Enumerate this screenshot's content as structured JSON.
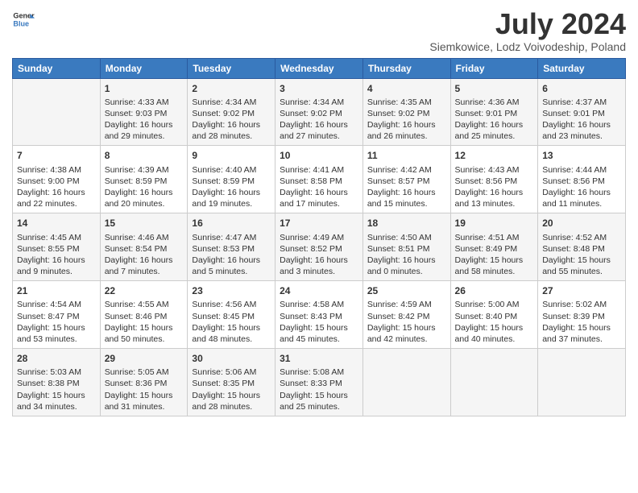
{
  "header": {
    "logo_general": "General",
    "logo_blue": "Blue",
    "month_year": "July 2024",
    "location": "Siemkowice, Lodz Voivodeship, Poland"
  },
  "days_of_week": [
    "Sunday",
    "Monday",
    "Tuesday",
    "Wednesday",
    "Thursday",
    "Friday",
    "Saturday"
  ],
  "weeks": [
    [
      {
        "day": "",
        "content": ""
      },
      {
        "day": "1",
        "content": "Sunrise: 4:33 AM\nSunset: 9:03 PM\nDaylight: 16 hours\nand 29 minutes."
      },
      {
        "day": "2",
        "content": "Sunrise: 4:34 AM\nSunset: 9:02 PM\nDaylight: 16 hours\nand 28 minutes."
      },
      {
        "day": "3",
        "content": "Sunrise: 4:34 AM\nSunset: 9:02 PM\nDaylight: 16 hours\nand 27 minutes."
      },
      {
        "day": "4",
        "content": "Sunrise: 4:35 AM\nSunset: 9:02 PM\nDaylight: 16 hours\nand 26 minutes."
      },
      {
        "day": "5",
        "content": "Sunrise: 4:36 AM\nSunset: 9:01 PM\nDaylight: 16 hours\nand 25 minutes."
      },
      {
        "day": "6",
        "content": "Sunrise: 4:37 AM\nSunset: 9:01 PM\nDaylight: 16 hours\nand 23 minutes."
      }
    ],
    [
      {
        "day": "7",
        "content": "Sunrise: 4:38 AM\nSunset: 9:00 PM\nDaylight: 16 hours\nand 22 minutes."
      },
      {
        "day": "8",
        "content": "Sunrise: 4:39 AM\nSunset: 8:59 PM\nDaylight: 16 hours\nand 20 minutes."
      },
      {
        "day": "9",
        "content": "Sunrise: 4:40 AM\nSunset: 8:59 PM\nDaylight: 16 hours\nand 19 minutes."
      },
      {
        "day": "10",
        "content": "Sunrise: 4:41 AM\nSunset: 8:58 PM\nDaylight: 16 hours\nand 17 minutes."
      },
      {
        "day": "11",
        "content": "Sunrise: 4:42 AM\nSunset: 8:57 PM\nDaylight: 16 hours\nand 15 minutes."
      },
      {
        "day": "12",
        "content": "Sunrise: 4:43 AM\nSunset: 8:56 PM\nDaylight: 16 hours\nand 13 minutes."
      },
      {
        "day": "13",
        "content": "Sunrise: 4:44 AM\nSunset: 8:56 PM\nDaylight: 16 hours\nand 11 minutes."
      }
    ],
    [
      {
        "day": "14",
        "content": "Sunrise: 4:45 AM\nSunset: 8:55 PM\nDaylight: 16 hours\nand 9 minutes."
      },
      {
        "day": "15",
        "content": "Sunrise: 4:46 AM\nSunset: 8:54 PM\nDaylight: 16 hours\nand 7 minutes."
      },
      {
        "day": "16",
        "content": "Sunrise: 4:47 AM\nSunset: 8:53 PM\nDaylight: 16 hours\nand 5 minutes."
      },
      {
        "day": "17",
        "content": "Sunrise: 4:49 AM\nSunset: 8:52 PM\nDaylight: 16 hours\nand 3 minutes."
      },
      {
        "day": "18",
        "content": "Sunrise: 4:50 AM\nSunset: 8:51 PM\nDaylight: 16 hours\nand 0 minutes."
      },
      {
        "day": "19",
        "content": "Sunrise: 4:51 AM\nSunset: 8:49 PM\nDaylight: 15 hours\nand 58 minutes."
      },
      {
        "day": "20",
        "content": "Sunrise: 4:52 AM\nSunset: 8:48 PM\nDaylight: 15 hours\nand 55 minutes."
      }
    ],
    [
      {
        "day": "21",
        "content": "Sunrise: 4:54 AM\nSunset: 8:47 PM\nDaylight: 15 hours\nand 53 minutes."
      },
      {
        "day": "22",
        "content": "Sunrise: 4:55 AM\nSunset: 8:46 PM\nDaylight: 15 hours\nand 50 minutes."
      },
      {
        "day": "23",
        "content": "Sunrise: 4:56 AM\nSunset: 8:45 PM\nDaylight: 15 hours\nand 48 minutes."
      },
      {
        "day": "24",
        "content": "Sunrise: 4:58 AM\nSunset: 8:43 PM\nDaylight: 15 hours\nand 45 minutes."
      },
      {
        "day": "25",
        "content": "Sunrise: 4:59 AM\nSunset: 8:42 PM\nDaylight: 15 hours\nand 42 minutes."
      },
      {
        "day": "26",
        "content": "Sunrise: 5:00 AM\nSunset: 8:40 PM\nDaylight: 15 hours\nand 40 minutes."
      },
      {
        "day": "27",
        "content": "Sunrise: 5:02 AM\nSunset: 8:39 PM\nDaylight: 15 hours\nand 37 minutes."
      }
    ],
    [
      {
        "day": "28",
        "content": "Sunrise: 5:03 AM\nSunset: 8:38 PM\nDaylight: 15 hours\nand 34 minutes."
      },
      {
        "day": "29",
        "content": "Sunrise: 5:05 AM\nSunset: 8:36 PM\nDaylight: 15 hours\nand 31 minutes."
      },
      {
        "day": "30",
        "content": "Sunrise: 5:06 AM\nSunset: 8:35 PM\nDaylight: 15 hours\nand 28 minutes."
      },
      {
        "day": "31",
        "content": "Sunrise: 5:08 AM\nSunset: 8:33 PM\nDaylight: 15 hours\nand 25 minutes."
      },
      {
        "day": "",
        "content": ""
      },
      {
        "day": "",
        "content": ""
      },
      {
        "day": "",
        "content": ""
      }
    ]
  ]
}
